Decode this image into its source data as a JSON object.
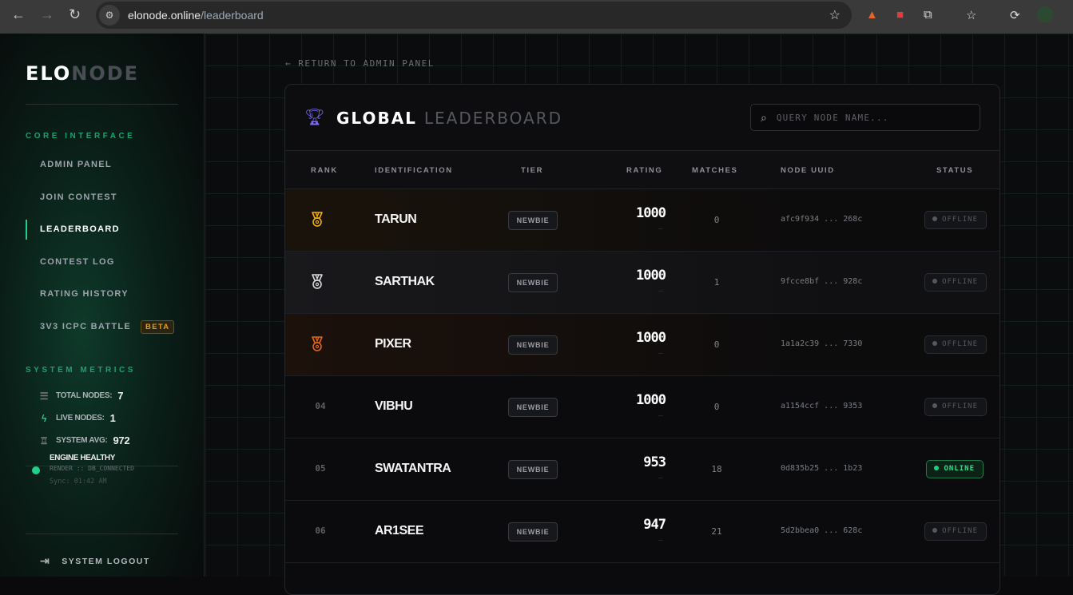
{
  "browser": {
    "url_domain": "elonode.online",
    "url_path": "/leaderboard"
  },
  "sidebar": {
    "logo_a": "ELO",
    "logo_b": "NODE",
    "core_title": "CORE INTERFACE",
    "items": [
      {
        "label": "ADMIN PANEL"
      },
      {
        "label": "JOIN CONTEST"
      },
      {
        "label": "LEADERBOARD",
        "active": true
      },
      {
        "label": "CONTEST LOG"
      },
      {
        "label": "RATING HISTORY"
      },
      {
        "label": "3V3 ICPC BATTLE",
        "badge": "BETA"
      }
    ],
    "metrics_title": "SYSTEM METRICS",
    "metrics": [
      {
        "label": "TOTAL NODES:",
        "value": "7",
        "icon": "database-icon"
      },
      {
        "label": "LIVE NODES:",
        "value": "1",
        "icon": "bolt-icon"
      },
      {
        "label": "SYSTEM AVG:",
        "value": "972",
        "icon": "trophy-icon"
      }
    ],
    "health": {
      "title": "ENGINE HEALTHY",
      "sub": "RENDER :: DB_CONNECTED",
      "sync": "Sync: 01:42 AM"
    },
    "logout": "SYSTEM LOGOUT"
  },
  "main": {
    "back": "RETURN TO ADMIN PANEL",
    "title_a": "GLOBAL",
    "title_b": "LEADERBOARD",
    "search_placeholder": "QUERY NODE NAME...",
    "columns": [
      "RANK",
      "IDENTIFICATION",
      "TIER",
      "RATING",
      "MATCHES",
      "NODE UUID",
      "STATUS"
    ],
    "rows": [
      {
        "rank": "01",
        "name": "TARUN",
        "tier": "NEWBIE",
        "rating": "1000",
        "delta": "--",
        "matches": "0",
        "uuid": "afc9f934 ... 268c",
        "status": "OFFLINE"
      },
      {
        "rank": "02",
        "name": "SARTHAK",
        "tier": "NEWBIE",
        "rating": "1000",
        "delta": "--",
        "matches": "1",
        "uuid": "9fcce8bf ... 928c",
        "status": "OFFLINE"
      },
      {
        "rank": "03",
        "name": "PIXER",
        "tier": "NEWBIE",
        "rating": "1000",
        "delta": "--",
        "matches": "0",
        "uuid": "1a1a2c39 ... 7330",
        "status": "OFFLINE"
      },
      {
        "rank": "04",
        "name": "VIBHU",
        "tier": "NEWBIE",
        "rating": "1000",
        "delta": "--",
        "matches": "0",
        "uuid": "a1154ccf ... 9353",
        "status": "OFFLINE"
      },
      {
        "rank": "05",
        "name": "SWATANTRA",
        "tier": "NEWBIE",
        "rating": "953",
        "delta": "--",
        "matches": "18",
        "uuid": "0d835b25 ... 1b23",
        "status": "ONLINE"
      },
      {
        "rank": "06",
        "name": "AR1SEE",
        "tier": "NEWBIE",
        "rating": "947",
        "delta": "--",
        "matches": "21",
        "uuid": "5d2bbea0 ... 628c",
        "status": "OFFLINE"
      }
    ]
  },
  "colors": {
    "accent": "#1fd08a",
    "gold": "#f0b010",
    "silver": "#d8d8d8",
    "bronze": "#e0661a",
    "purple": "#7b6cf6"
  }
}
